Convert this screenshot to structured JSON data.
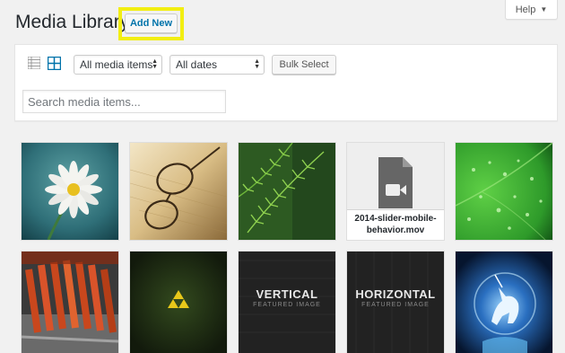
{
  "header": {
    "title": "Media Library",
    "add_new_label": "Add New",
    "help_label": "Help"
  },
  "toolbar": {
    "media_type_select": "All media items",
    "date_select": "All dates",
    "bulk_select_label": "Bulk Select",
    "search_placeholder": "Search media items..."
  },
  "media": {
    "items": [
      {
        "kind": "image",
        "subject": "daisy"
      },
      {
        "kind": "image",
        "subject": "glasses-on-paper"
      },
      {
        "kind": "image",
        "subject": "fern"
      },
      {
        "kind": "file",
        "icon": "video-file-icon",
        "filename": "2014-slider-mobile-behavior.mov"
      },
      {
        "kind": "image",
        "subject": "green-leaf-drops"
      },
      {
        "kind": "image",
        "subject": "ribs-grill"
      },
      {
        "kind": "image",
        "subject": "triforce"
      },
      {
        "kind": "image",
        "subject": "vertical-featured",
        "big": "VERTICAL",
        "small": "FEATURED IMAGE"
      },
      {
        "kind": "image",
        "subject": "horizontal-featured",
        "big": "HORIZONTAL",
        "small": "FEATURED IMAGE"
      },
      {
        "kind": "image",
        "subject": "unicorn"
      }
    ]
  },
  "colors": {
    "highlight": "#f2ee12",
    "link": "#0073aa",
    "background": "#f1f1f1"
  }
}
